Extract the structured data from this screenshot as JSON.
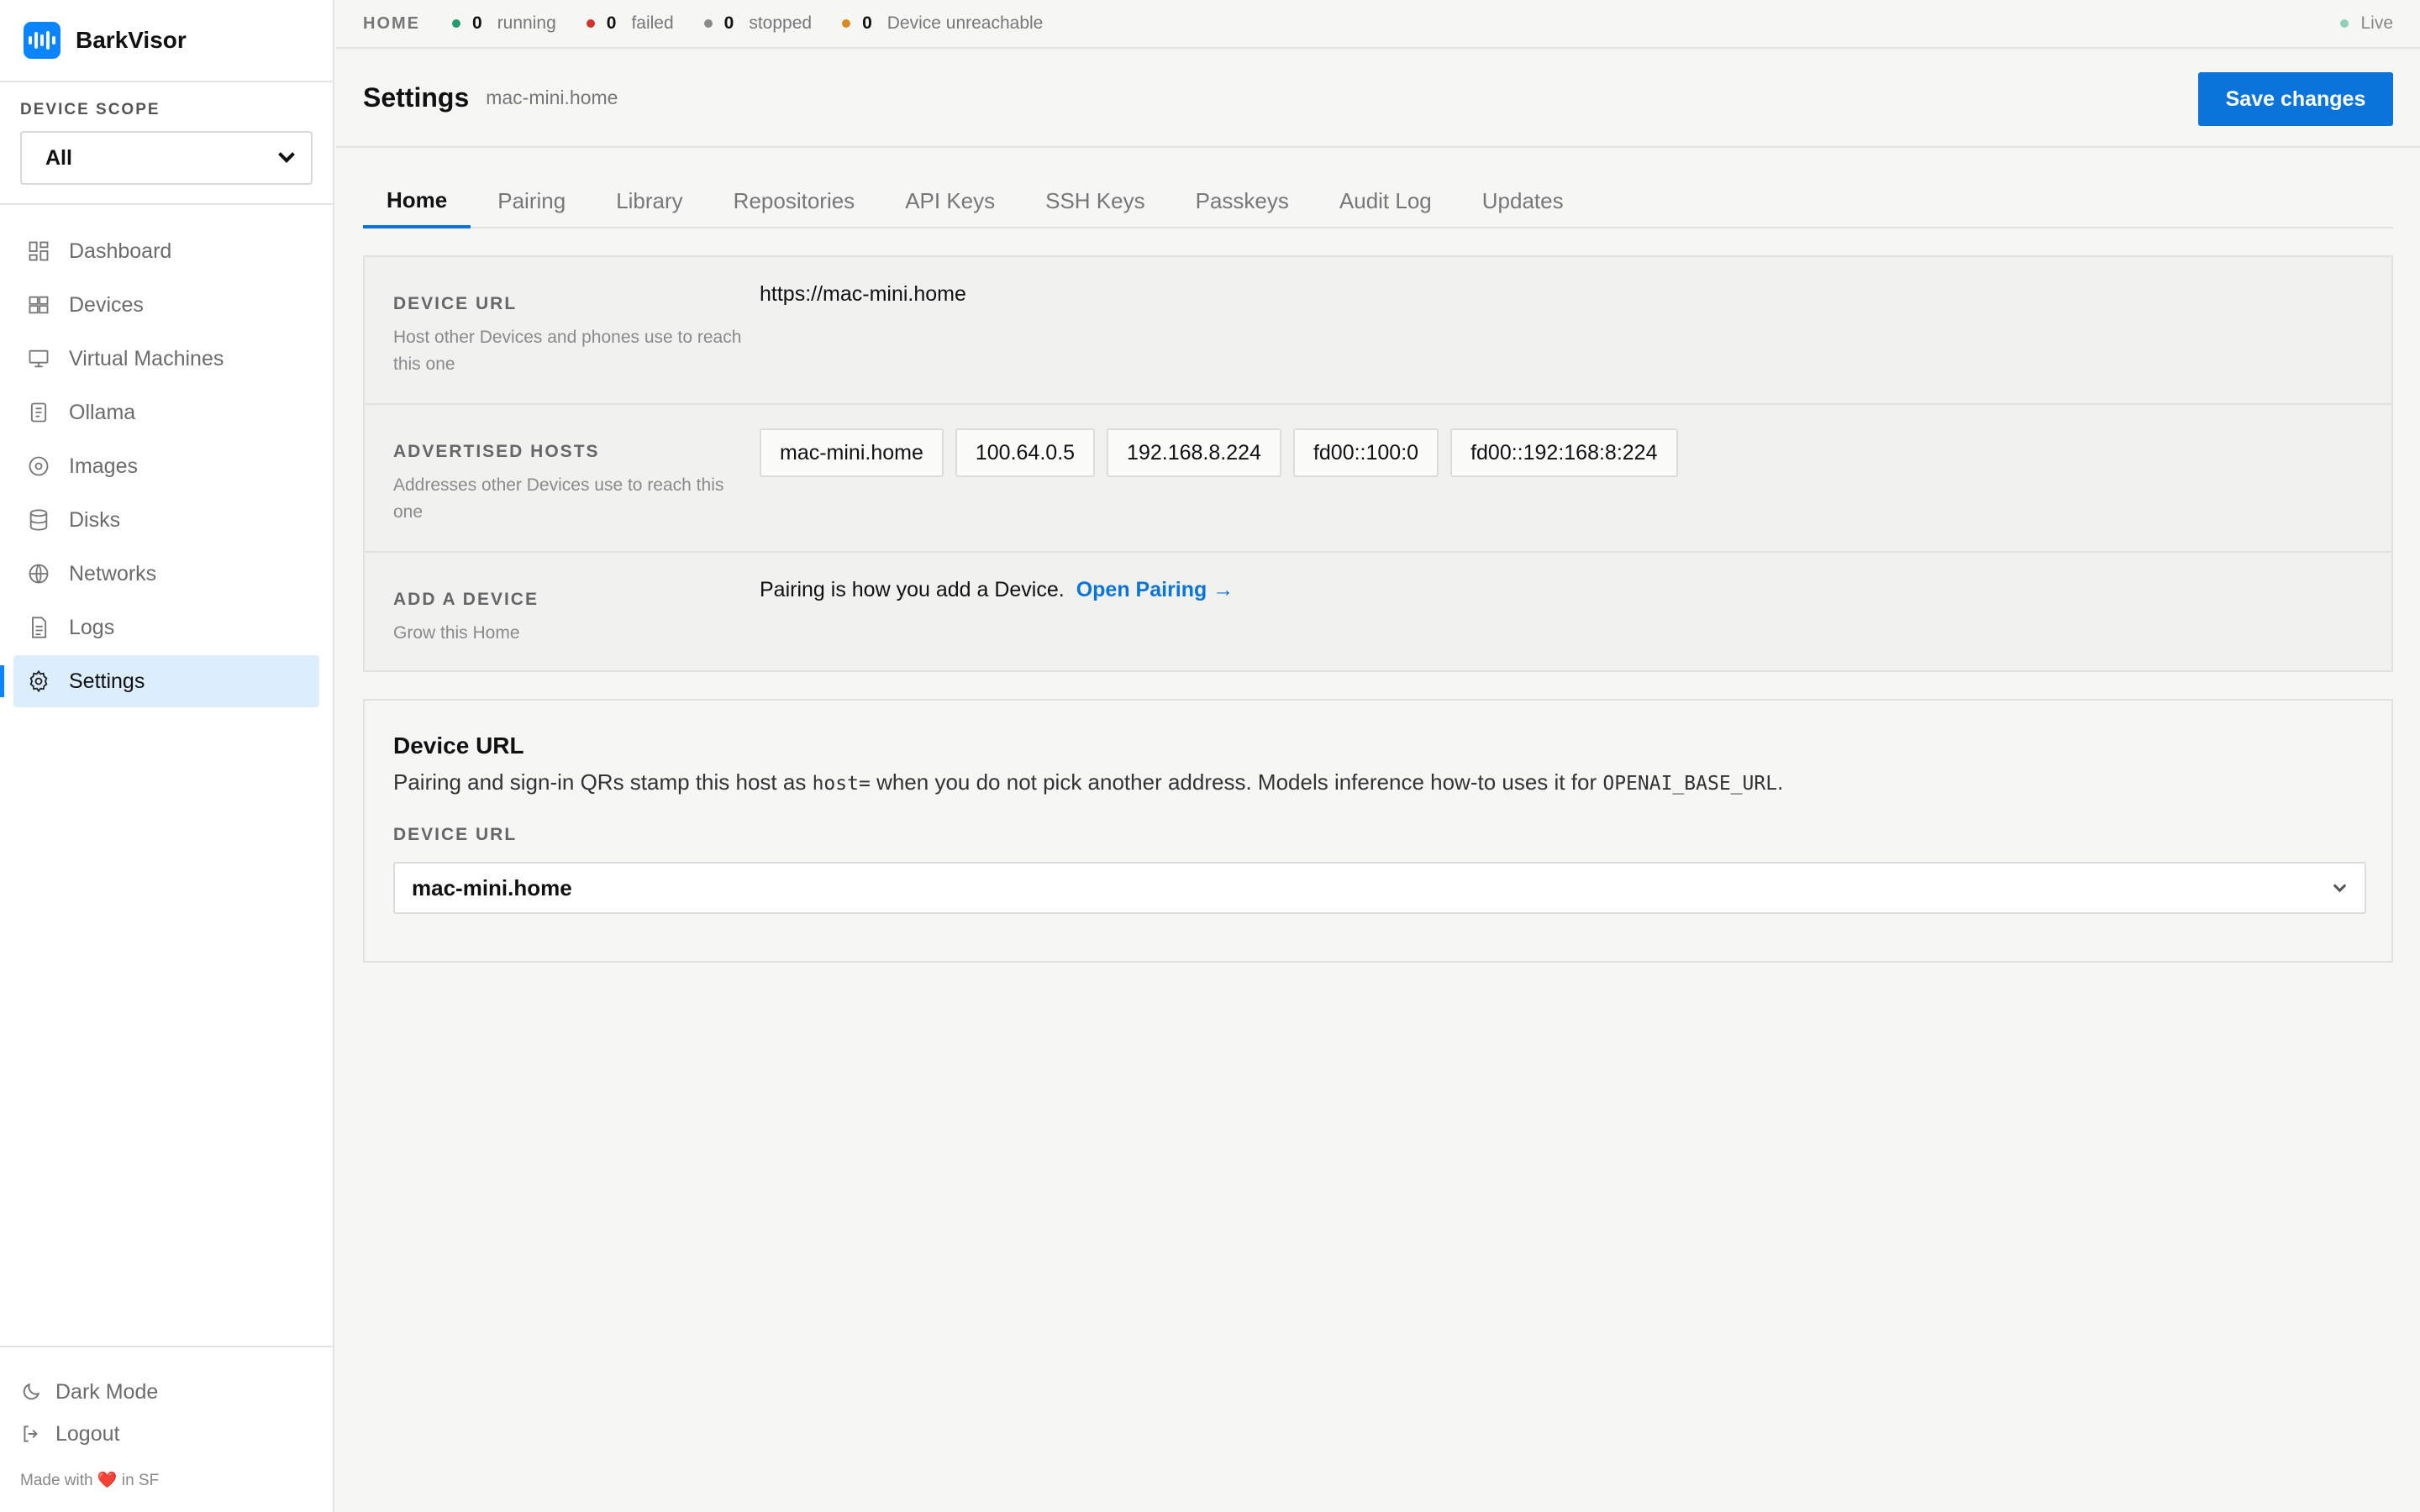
{
  "app": {
    "name": "BarkVisor",
    "logo_icon": "waveform-icon",
    "accent": "#0a84ff"
  },
  "sidebar": {
    "scope_label": "DEVICE SCOPE",
    "scope_value": "All",
    "items": [
      {
        "label": "Dashboard",
        "icon": "dashboard-icon",
        "active": false
      },
      {
        "label": "Devices",
        "icon": "devices-icon",
        "active": false
      },
      {
        "label": "Virtual Machines",
        "icon": "monitor-icon",
        "active": false
      },
      {
        "label": "Ollama",
        "icon": "ollama-icon",
        "active": false
      },
      {
        "label": "Images",
        "icon": "disc-icon",
        "active": false
      },
      {
        "label": "Disks",
        "icon": "database-icon",
        "active": false
      },
      {
        "label": "Networks",
        "icon": "globe-icon",
        "active": false
      },
      {
        "label": "Logs",
        "icon": "file-text-icon",
        "active": false
      },
      {
        "label": "Settings",
        "icon": "gear-icon",
        "active": true
      }
    ],
    "dark_mode": "Dark Mode",
    "logout": "Logout",
    "made_with_prefix": "Made with",
    "made_with_suffix": "in SF"
  },
  "topbar": {
    "crumb": "HOME",
    "stats": [
      {
        "count": "0",
        "label": "running",
        "color": "#1f9d6b"
      },
      {
        "count": "0",
        "label": "failed",
        "color": "#d6302b"
      },
      {
        "count": "0",
        "label": "stopped",
        "color": "#8a8a8a"
      },
      {
        "count": "0",
        "label": "Device unreachable",
        "color": "#d98a1a"
      }
    ],
    "live": "Live"
  },
  "header": {
    "title": "Settings",
    "subtitle": "mac-mini.home",
    "save_label": "Save changes"
  },
  "tabs": [
    {
      "label": "Home",
      "active": true
    },
    {
      "label": "Pairing"
    },
    {
      "label": "Library"
    },
    {
      "label": "Repositories"
    },
    {
      "label": "API Keys"
    },
    {
      "label": "SSH Keys"
    },
    {
      "label": "Passkeys"
    },
    {
      "label": "Audit Log"
    },
    {
      "label": "Updates"
    }
  ],
  "settings": {
    "device_url": {
      "label": "DEVICE URL",
      "desc": "Host other Devices and phones use to reach this one",
      "value": "https://mac-mini.home"
    },
    "advertised_hosts": {
      "label": "ADVERTISED HOSTS",
      "desc": "Addresses other Devices use to reach this one",
      "hosts": [
        "mac-mini.home",
        "100.64.0.5",
        "192.168.8.224",
        "fd00::100:0",
        "fd00::192:168:8:224"
      ]
    },
    "add_device": {
      "label": "ADD A DEVICE",
      "desc": "Grow this Home",
      "text": "Pairing is how you add a Device.",
      "link": "Open Pairing →"
    }
  },
  "device_url_section": {
    "title": "Device URL",
    "text_1": "Pairing and sign-in QRs stamp this host as",
    "code_1": "host=",
    "text_2": "when you do not pick another address. Models inference how-to uses it for",
    "code_2": "OPENAI_BASE_URL",
    "text_3": ".",
    "field_label": "DEVICE URL",
    "field_value": "mac-mini.home"
  }
}
